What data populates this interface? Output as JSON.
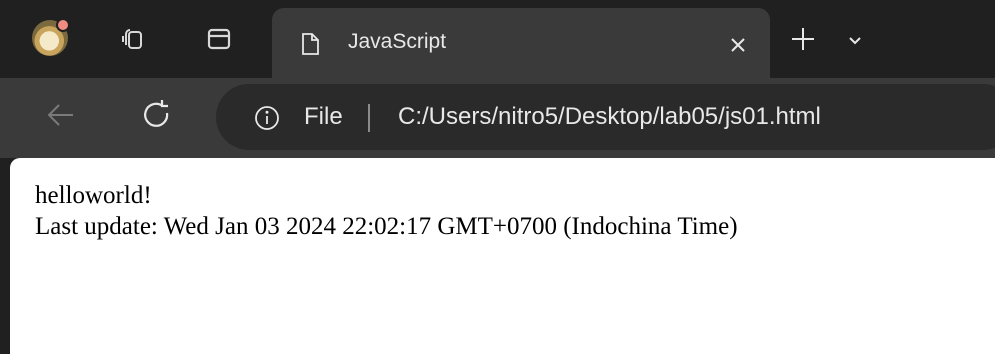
{
  "browser": {
    "tab": {
      "title": "JavaScript",
      "icon": "file-icon"
    },
    "toolbar": {
      "back_icon": "back-arrow-icon",
      "reload_icon": "reload-icon"
    },
    "address_bar": {
      "site_info_icon": "info-icon",
      "scheme_label": "File",
      "url": "C:/Users/nitro5/Desktop/lab05/js01.html"
    }
  },
  "page": {
    "lines": [
      "helloworld!",
      "Last update: Wed Jan 03 2024 22:02:17 GMT+0700 (Indochina Time)"
    ]
  },
  "colors": {
    "frame": "#202020",
    "toolbar": "#3a3a3a",
    "omnibox": "#2a2a2a",
    "notification_dot": "#f28b82"
  }
}
